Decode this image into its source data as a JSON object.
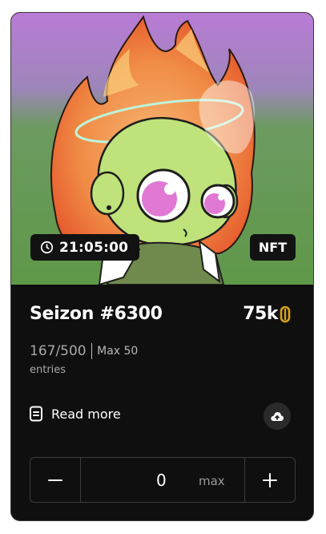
{
  "card": {
    "badge_timer": "21:05:00",
    "badge_type": "NFT",
    "title": "Seizon #6300",
    "price": "75k",
    "entries_count": "167/500",
    "max_label": "Max 50",
    "entries_label": "entries",
    "read_more_label": "Read more",
    "quantity_value": "0",
    "quantity_max_hint": "max"
  },
  "icons": {
    "timer": "clock-icon",
    "currency": "coin-icon",
    "read_more": "document-icon",
    "upload": "cloud-upload-icon",
    "minus": "minus-icon",
    "plus": "plus-icon"
  },
  "colors": {
    "card_bg": "#0f0f0f",
    "accent_coin": "#d9a21b",
    "muted_text": "#a9a9a9"
  }
}
